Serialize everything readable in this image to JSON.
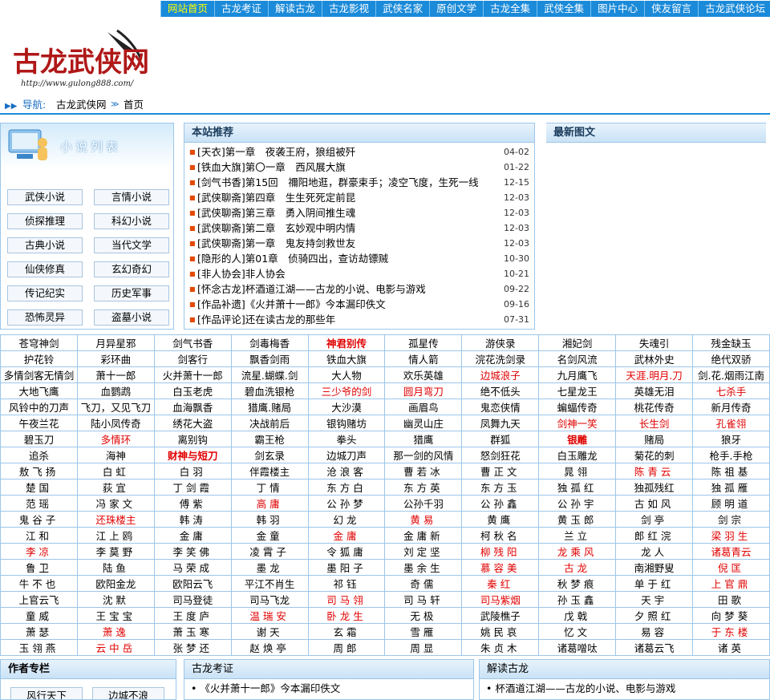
{
  "topnav": [
    "网站首页",
    "古龙考证",
    "解读古龙",
    "古龙影视",
    "武侠名家",
    "原创文学",
    "古龙全集",
    "武侠全集",
    "图片中心",
    "侠友留言",
    "古龙武侠论坛"
  ],
  "logo": {
    "text": "古龙武侠网",
    "url": "http://www.gulong888.com/"
  },
  "breadcrumb": {
    "label": "导航:",
    "site": "古龙武侠网",
    "page": "首页"
  },
  "novel_list": {
    "title": "小说列表",
    "items": [
      "武侠小说",
      "言情小说",
      "侦探推理",
      "科幻小说",
      "古典小说",
      "当代文学",
      "仙侠修真",
      "玄幻奇幻",
      "传记纪实",
      "历史军事",
      "恐怖灵异",
      "盗墓小说"
    ]
  },
  "recommend": {
    "title": "本站推荐",
    "items": [
      {
        "t": "[天衣]第一章　夜袭王府，狼组被歼",
        "d": "04-02"
      },
      {
        "t": "[铁血大旗]第〇一章　西风展大旗",
        "d": "01-22"
      },
      {
        "t": "[剑气书香]第15回　禰阳地逛，群豪束手；凌空飞度，生死一线",
        "d": "12-15"
      },
      {
        "t": "[武侠聊斋]第四章　生生死死定前昆",
        "d": "12-03"
      },
      {
        "t": "[武侠聊斋]第三章　勇入阴间推生魂",
        "d": "12-03"
      },
      {
        "t": "[武侠聊斋]第二章　玄妙观中明内情",
        "d": "12-03"
      },
      {
        "t": "[武侠聊斋]第一章　鬼友持剑救世友",
        "d": "12-03"
      },
      {
        "t": "[隐形的人]第01章　侦骑四出，查访劫镖贼",
        "d": "10-30"
      },
      {
        "t": "[非人协会]非人协会",
        "d": "10-21"
      },
      {
        "t": "[怀念古龙]杯酒道江湖——古龙的小说、电影与游戏",
        "d": "09-22"
      },
      {
        "t": "[作品补遗]《火并萧十一郎》今本漏印佚文",
        "d": "09-16"
      },
      {
        "t": "[作品评论]还在读古龙的那些年",
        "d": "07-31"
      }
    ]
  },
  "latest": {
    "title": "最新图文"
  },
  "works": [
    [
      "苍穹神剑",
      "月异星邪",
      "剑气书香",
      "剑毒梅香",
      "神君别传",
      "孤星传",
      "游侠录",
      "湘妃剑",
      "失魂引",
      "残金缺玉"
    ],
    [
      "护花铃",
      "彩环曲",
      "剑客行",
      "飘香剑雨",
      "铁血大旗",
      "情人箭",
      "浣花洗剑录",
      "名剑风流",
      "武林外史",
      "绝代双骄"
    ],
    [
      "多情剑客无情剑",
      "萧十一郎",
      "火并萧十一郎",
      "流星.蝴蝶.剑",
      "大人物",
      "欢乐英雄",
      "边城浪子",
      "九月鹰飞",
      "天涯.明月.刀",
      "剑.花.烟雨江南"
    ],
    [
      "大地飞鹰",
      "血鹦鹉",
      "白玉老虎",
      "碧血洗银枪",
      "三少爷的剑",
      "圆月弯刀",
      "绝不低头",
      "七星龙王",
      "英雄无泪",
      "七杀手"
    ],
    [
      "风铃中的刀声",
      "飞刀，又见飞刀",
      "血海飘香",
      "猎鹰.赌局",
      "大沙漠",
      "画眉鸟",
      "鬼恋侠情",
      "蝙蝠传奇",
      "桃花传奇",
      "新月传奇"
    ],
    [
      "午夜兰花",
      "陆小凤传奇",
      "绣花大盗",
      "决战前后",
      "银钩赌坊",
      "幽灵山庄",
      "凤舞九天",
      "剑神一笑",
      "长生剑",
      "孔雀翎"
    ],
    [
      "碧玉刀",
      "多情环",
      "离别钩",
      "霸王枪",
      "拳头",
      "猎鹰",
      "群狐",
      "银雕",
      "赌局",
      "狼牙"
    ],
    [
      "追杀",
      "海神",
      "财神与短刀",
      "剑玄录",
      "边城刀声",
      "那一剑的风情",
      "怒剑狂花",
      "白玉雕龙",
      "菊花的刺",
      "枪手.手枪"
    ]
  ],
  "works_red": [
    [
      0,
      4
    ],
    [
      2,
      6
    ],
    [
      2,
      8
    ],
    [
      3,
      4
    ],
    [
      3,
      5
    ],
    [
      3,
      9
    ],
    [
      5,
      7
    ],
    [
      5,
      8
    ],
    [
      5,
      9
    ],
    [
      6,
      1
    ],
    [
      6,
      7
    ],
    [
      7,
      2
    ]
  ],
  "works_bold": [
    [
      0,
      4
    ],
    [
      6,
      7
    ],
    [
      7,
      2
    ]
  ],
  "authors": [
    [
      "敖飞扬",
      "白虹",
      "白羽",
      "伴霞楼主",
      "沧浪客",
      "曹若冰",
      "曹正文",
      "晁翎",
      "陈青云",
      "陈祖基"
    ],
    [
      "楚国",
      "荻宜",
      "丁剑霞",
      "丁情",
      "东方白",
      "东方英",
      "东方玉",
      "独孤红",
      "独孤残红",
      "独孤雁"
    ],
    [
      "范瑶",
      "冯家文",
      "傅紫",
      "高庸",
      "公孙梦",
      "公孙千羽",
      "公孙鑫",
      "公孙宇",
      "古如风",
      "顾明道"
    ],
    [
      "鬼谷子",
      "还珠楼主",
      "韩涛",
      "韩羽",
      "幻龙",
      "黄易",
      "黄鹰",
      "黄玉郎",
      "剑亭",
      "剑宗"
    ],
    [
      "江和",
      "江上鸥",
      "金庸",
      "金童",
      "金庸",
      "金庸新",
      "柯秋名",
      "兰立",
      "郎红浣",
      "梁羽生"
    ],
    [
      "李凉",
      "李莫野",
      "李笑佛",
      "凌霄子",
      "令狐庸",
      "刘定坚",
      "柳残阳",
      "龙乘风",
      "龙人",
      "诸葛青云"
    ],
    [
      "鲁卫",
      "陆鱼",
      "马荣成",
      "墨龙",
      "墨阳子",
      "墨余生",
      "慕容美",
      "古龙",
      "南湘野叟",
      "倪匡"
    ],
    [
      "牛不也",
      "欧阳金龙",
      "欧阳云飞",
      "平江不肖生",
      "祁钰",
      "奇儒",
      "秦红",
      "秋梦痕",
      "单于红",
      "上官鼎"
    ],
    [
      "上官云飞",
      "沈默",
      "司马登徒",
      "司马飞龙",
      "司马翎",
      "司马轩",
      "司马紫烟",
      "孙玉鑫",
      "天宇",
      "田歌"
    ],
    [
      "童威",
      "王宝宝",
      "王度庐",
      "温瑞安",
      "卧龙生",
      "无极",
      "武陵樵子",
      "戊戟",
      "夕照红",
      "向梦葵"
    ],
    [
      "萧瑟",
      "萧逸",
      "萧玉寒",
      "谢天",
      "玄霜",
      "雪雁",
      "姚民哀",
      "忆文",
      "易容",
      "于东楼"
    ],
    [
      "玉翎燕",
      "云中岳",
      "张梦还",
      "赵焕亭",
      "周郎",
      "周显",
      "朱贞木",
      "诸葛噌呔",
      "诸葛云飞",
      "诸英"
    ]
  ],
  "authors_red": [
    [
      0,
      8
    ],
    [
      2,
      3
    ],
    [
      3,
      1
    ],
    [
      3,
      5
    ],
    [
      4,
      4
    ],
    [
      4,
      9
    ],
    [
      5,
      0
    ],
    [
      5,
      6
    ],
    [
      5,
      7
    ],
    [
      5,
      9
    ],
    [
      6,
      6
    ],
    [
      6,
      7
    ],
    [
      6,
      9
    ],
    [
      7,
      6
    ],
    [
      7,
      9
    ],
    [
      8,
      4
    ],
    [
      8,
      6
    ],
    [
      9,
      3
    ],
    [
      9,
      4
    ],
    [
      10,
      1
    ],
    [
      10,
      9
    ],
    [
      11,
      1
    ]
  ],
  "bottom": {
    "author_title": "作者专栏",
    "author_tags": [
      "风行天下",
      "边城不浪"
    ],
    "kaozheng_title": "古龙考证",
    "kaozheng_items": [
      "《火并萧十一郎》今本漏印佚文"
    ],
    "jiedu_title": "解读古龙",
    "jiedu_items": [
      "杯酒道江湖——古龙的小说、电影与游戏"
    ]
  }
}
